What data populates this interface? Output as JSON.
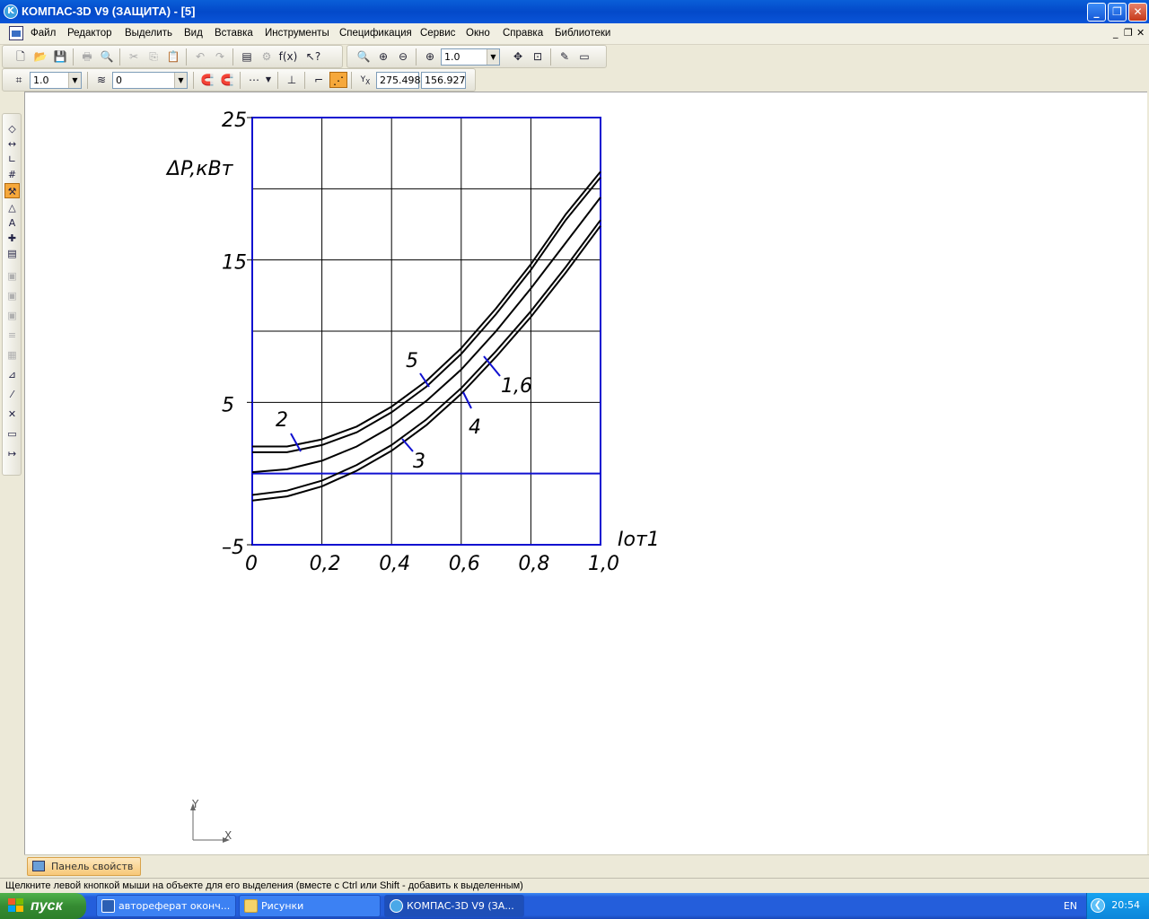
{
  "window": {
    "title": "КОМПАС-3D V9 (ЗАЩИТА) - [5]",
    "minimize": "_",
    "restore": "❐",
    "close": "✕"
  },
  "menu": {
    "items": [
      "Файл",
      "Редактор",
      "Выделить",
      "Вид",
      "Вставка",
      "Инструменты",
      "Спецификация",
      "Сервис",
      "Окно",
      "Справка",
      "Библиотеки"
    ],
    "mdi_min": "_",
    "mdi_restore": "❐",
    "mdi_close": "✕"
  },
  "toolbar": {
    "zoom_value": "1.0",
    "step_value": "1.0",
    "layer_value": "0",
    "coord_x": "275.498",
    "coord_y": "156.927",
    "fx_label": "f(x)"
  },
  "chart_data": {
    "type": "line",
    "ylabel": "ΔP,кВт",
    "xlabel": "Iот1",
    "xlim": [
      0,
      1.0
    ],
    "ylim": [
      -5,
      25
    ],
    "x_ticks": [
      "0",
      "0,2",
      "0,4",
      "0,6",
      "0,8",
      "1,0"
    ],
    "y_ticks": [
      "25",
      "15",
      "5",
      "–5"
    ],
    "grid": true,
    "series_labels": [
      "2",
      "5",
      "1,6",
      "4",
      "3"
    ],
    "series": [
      {
        "values_x": [
          0,
          0.1,
          0.2,
          0.3,
          0.4,
          0.5,
          0.6,
          0.7,
          0.8,
          0.9,
          1.0
        ],
        "values_y": [
          1.9,
          1.9,
          2.4,
          3.3,
          4.7,
          6.5,
          8.8,
          11.6,
          14.7,
          18.2,
          21.2
        ]
      },
      {
        "values_x": [
          0,
          0.1,
          0.2,
          0.3,
          0.4,
          0.5,
          0.6,
          0.7,
          0.8,
          0.9,
          1.0
        ],
        "values_y": [
          1.5,
          1.5,
          2.0,
          2.9,
          4.3,
          6.1,
          8.4,
          11.2,
          14.3,
          17.8,
          20.8
        ]
      },
      {
        "values_x": [
          0,
          0.1,
          0.2,
          0.3,
          0.4,
          0.5,
          0.6,
          0.7,
          0.8,
          0.9,
          1.0
        ],
        "values_y": [
          0.1,
          0.3,
          0.9,
          1.9,
          3.3,
          5.1,
          7.3,
          10.0,
          13.0,
          16.2,
          19.4
        ]
      },
      {
        "values_x": [
          0,
          0.1,
          0.2,
          0.3,
          0.4,
          0.5,
          0.6,
          0.7,
          0.8,
          0.9,
          1.0
        ],
        "values_y": [
          -1.5,
          -1.2,
          -0.5,
          0.6,
          2.0,
          3.8,
          6.0,
          8.6,
          11.4,
          14.5,
          17.8
        ]
      },
      {
        "values_x": [
          0,
          0.1,
          0.2,
          0.3,
          0.4,
          0.5,
          0.6,
          0.7,
          0.8,
          0.9,
          1.0
        ],
        "values_y": [
          -1.9,
          -1.6,
          -0.9,
          0.2,
          1.6,
          3.4,
          5.6,
          8.2,
          11.0,
          14.1,
          17.4
        ]
      }
    ]
  },
  "axes_widget": {
    "y": "Y",
    "x": "X"
  },
  "property_panel": {
    "tab_label": "Панель свойств"
  },
  "status": {
    "text": "Щелкните левой кнопкой мыши на объекте для его выделения (вместе с Ctrl или Shift - добавить к выделенным)"
  },
  "taskbar": {
    "start_label": "пуск",
    "tasks": [
      "автореферат оконч...",
      "Рисунки",
      "КОМПАС-3D V9 (ЗА..."
    ],
    "language": "EN",
    "clock": "20:54"
  }
}
